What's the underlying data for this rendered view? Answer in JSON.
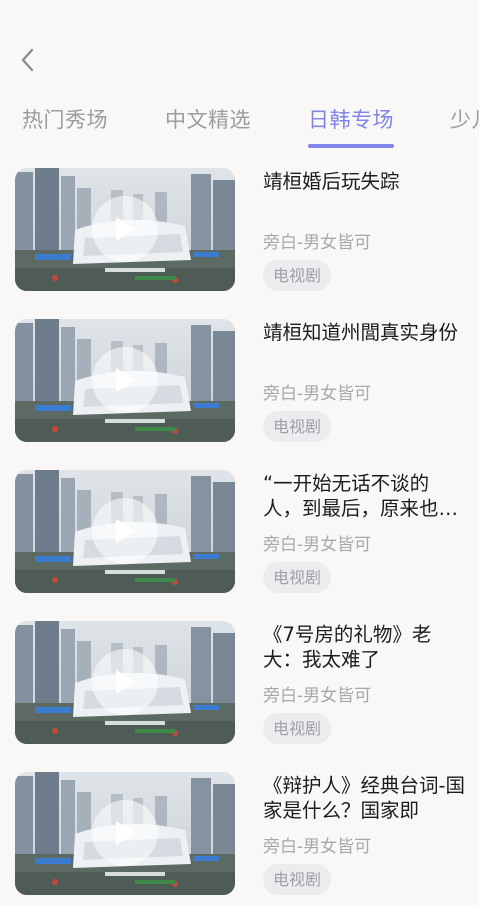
{
  "nav": {
    "back_icon": "chevron-left-icon"
  },
  "tabs": [
    {
      "label": "热门秀场",
      "active": false
    },
    {
      "label": "中文精选",
      "active": false
    },
    {
      "label": "日韩专场",
      "active": true
    },
    {
      "label": "少儿",
      "active": false
    }
  ],
  "items": [
    {
      "title": "靖桓婚后玩失踪",
      "narrator": "旁白-男女皆可",
      "tag": "电视剧"
    },
    {
      "title": "靖桓知道州閭真实身份",
      "narrator": "旁白-男女皆可",
      "tag": "电视剧"
    },
    {
      "title": "“一开始无话不谈的人，到最后，原来也…",
      "narrator": "旁白-男女皆可",
      "tag": "电视剧"
    },
    {
      "title": "《7号房的礼物》老大：我太难了",
      "narrator": "旁白-男女皆可",
      "tag": "电视剧"
    },
    {
      "title": "《辩护人》经典台词-国家是什么？国家即",
      "narrator": "旁白-男女皆可",
      "tag": "电视剧"
    }
  ],
  "colors": {
    "accent": "#7f86e8",
    "background": "#f9f8f6",
    "text": "#1c1c1e",
    "muted": "#a7a8ad",
    "tag_bg": "#ececee"
  }
}
